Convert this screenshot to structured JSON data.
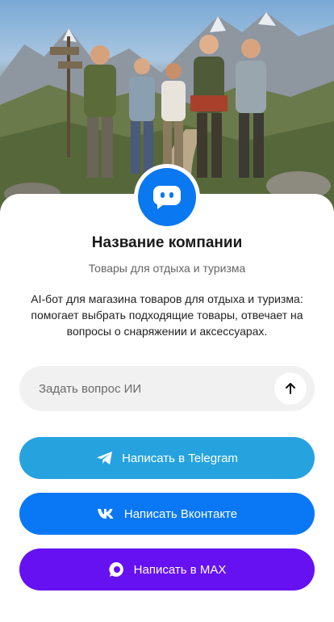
{
  "company": {
    "name": "Название компании",
    "tagline": "Товары для отдыха и туризма",
    "description": "AI-бот для магазина товаров для отдыха и туризма: помогает выбрать подходящие товары, отвечает на вопросы о снаряжении и аксессуарах."
  },
  "hero": {
    "image": "hikers-in-mountains-photo"
  },
  "avatar": {
    "icon": "chat-bot-icon"
  },
  "ask": {
    "placeholder": "Задать вопрос ИИ",
    "value": "",
    "send_icon": "arrow-up-icon"
  },
  "buttons": [
    {
      "label": "Написать в Telegram",
      "icon": "telegram-icon",
      "color": "#26a3df"
    },
    {
      "label": "Написать Вконтакте",
      "icon": "vk-icon",
      "color": "#0a78f5"
    },
    {
      "label": "Написать в MAX",
      "icon": "max-icon",
      "color": "#6611f2"
    }
  ],
  "colors": {
    "accent": "#0a78f0",
    "input_bg": "#f1f1f1"
  }
}
